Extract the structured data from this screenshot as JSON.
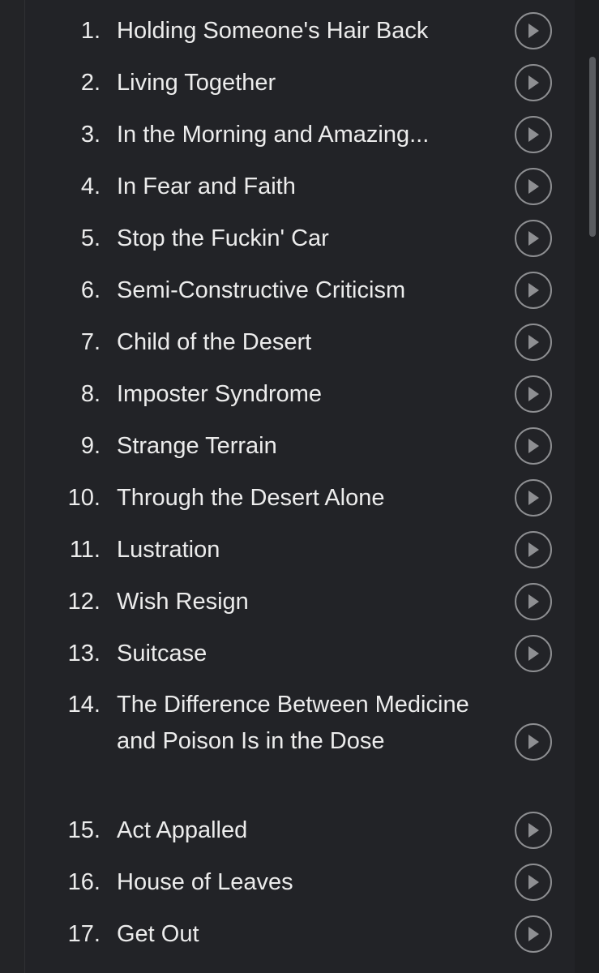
{
  "tracks": [
    {
      "number": "1.",
      "title": "Holding Someone's Hair Back"
    },
    {
      "number": "2.",
      "title": "Living Together"
    },
    {
      "number": "3.",
      "title": "In the Morning and Amazing..."
    },
    {
      "number": "4.",
      "title": "In Fear and Faith"
    },
    {
      "number": "5.",
      "title": "Stop the Fuckin' Car"
    },
    {
      "number": "6.",
      "title": "Semi-Constructive Criticism"
    },
    {
      "number": "7.",
      "title": "Child of the Desert"
    },
    {
      "number": "8.",
      "title": "Imposter Syndrome"
    },
    {
      "number": "9.",
      "title": "Strange Terrain"
    },
    {
      "number": "10.",
      "title": "Through the Desert Alone"
    },
    {
      "number": "11.",
      "title": "Lustration"
    },
    {
      "number": "12.",
      "title": "Wish Resign"
    },
    {
      "number": "13.",
      "title": "Suitcase"
    },
    {
      "number": "14.",
      "title": "The Difference Between Medicine and Poison Is in the Dose"
    },
    {
      "number": "15.",
      "title": "Act Appalled"
    },
    {
      "number": "16.",
      "title": "House of Leaves"
    },
    {
      "number": "17.",
      "title": "Get Out"
    }
  ],
  "icons": {
    "play": "play-circle-icon",
    "scrollbar": "scrollbar-thumb"
  },
  "colors": {
    "background": "#1f2023",
    "panel": "#222327",
    "text": "#ececec",
    "icon": "#8e8f92",
    "scroll_thumb": "#5a5c60"
  }
}
